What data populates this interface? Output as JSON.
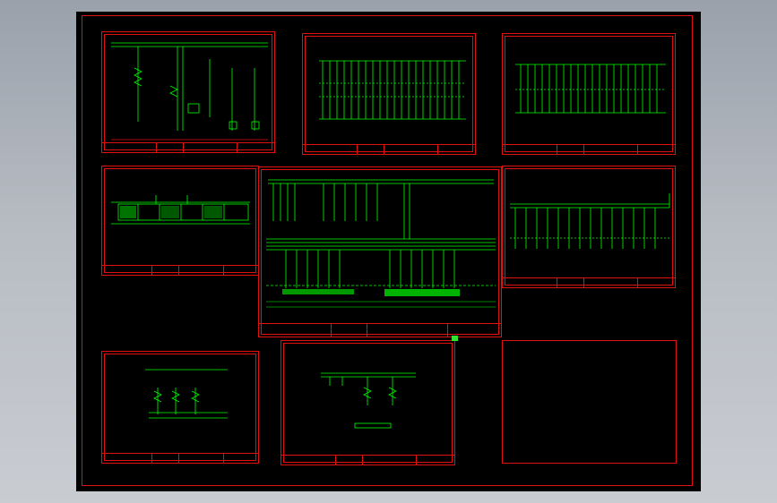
{
  "colors": {
    "frame": "#e01010",
    "wire": "#00ff00",
    "text": "#e8e8e8",
    "background": "#000000"
  },
  "sheets": [
    {
      "id": "s1",
      "title": "",
      "note": ""
    },
    {
      "id": "s2",
      "title": "",
      "note": ""
    },
    {
      "id": "s3",
      "title": "",
      "note": ""
    },
    {
      "id": "s4",
      "title": "",
      "note": ""
    },
    {
      "id": "s5",
      "title": "",
      "note": ""
    },
    {
      "id": "s6",
      "title": "",
      "note": ""
    },
    {
      "id": "s7",
      "title": "",
      "note": ""
    },
    {
      "id": "s8",
      "title": "",
      "note": ""
    },
    {
      "id": "s9",
      "title": "",
      "note": ""
    }
  ],
  "cursor": {
    "icon": "grip-handle-icon"
  }
}
